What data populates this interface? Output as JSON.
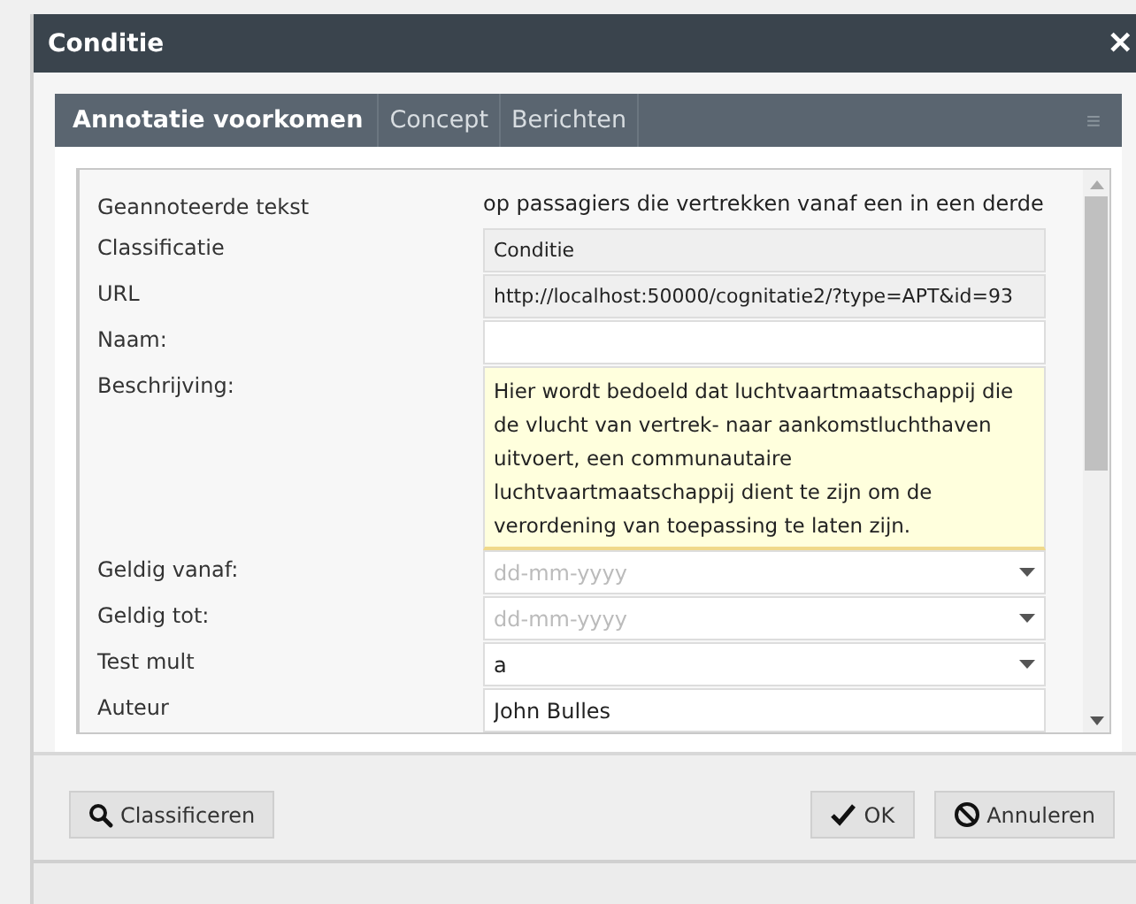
{
  "window": {
    "title": "Conditie",
    "close": "✕"
  },
  "tabs": [
    {
      "label": "Annotatie voorkomen",
      "selected": true
    },
    {
      "label": "Concept",
      "selected": false
    },
    {
      "label": "Berichten",
      "selected": false
    }
  ],
  "tab_menu": "≡",
  "fields": [
    {
      "label": "Geannoteerde tekst",
      "kind": "plain",
      "value": "op passagiers die vertrekken vanaf een in een derde"
    },
    {
      "label": "Classificatie",
      "kind": "readonly",
      "value": "Conditie"
    },
    {
      "label": "URL",
      "kind": "readonly",
      "value": "http://localhost:50000/cognitatie2/?type=APT&id=93"
    },
    {
      "label": "Naam:",
      "kind": "text"
    },
    {
      "label": "Beschrijving:",
      "kind": "textarea",
      "value": "Hier wordt bedoeld dat luchtvaartmaatschappij die de vlucht van vertrek- naar aankomstluchthaven uitvoert, een communautaire luchtvaartmaatschappij dient te zijn om de verordening van toepassing te laten zijn."
    },
    {
      "label": "Geldig vanaf:",
      "kind": "select",
      "placeholder": "dd-mm-yyyy"
    },
    {
      "label": "Geldig tot:",
      "kind": "select",
      "placeholder": "dd-mm-yyyy"
    },
    {
      "label": "Test mult",
      "kind": "select",
      "value": "a"
    },
    {
      "label": "Auteur",
      "kind": "text",
      "value": "John Bulles"
    }
  ],
  "buttons": [
    {
      "label": "Classificeren",
      "kind": "search"
    },
    {
      "label": "OK",
      "kind": "ok"
    },
    {
      "label": "Annuleren",
      "kind": "cancel"
    }
  ]
}
